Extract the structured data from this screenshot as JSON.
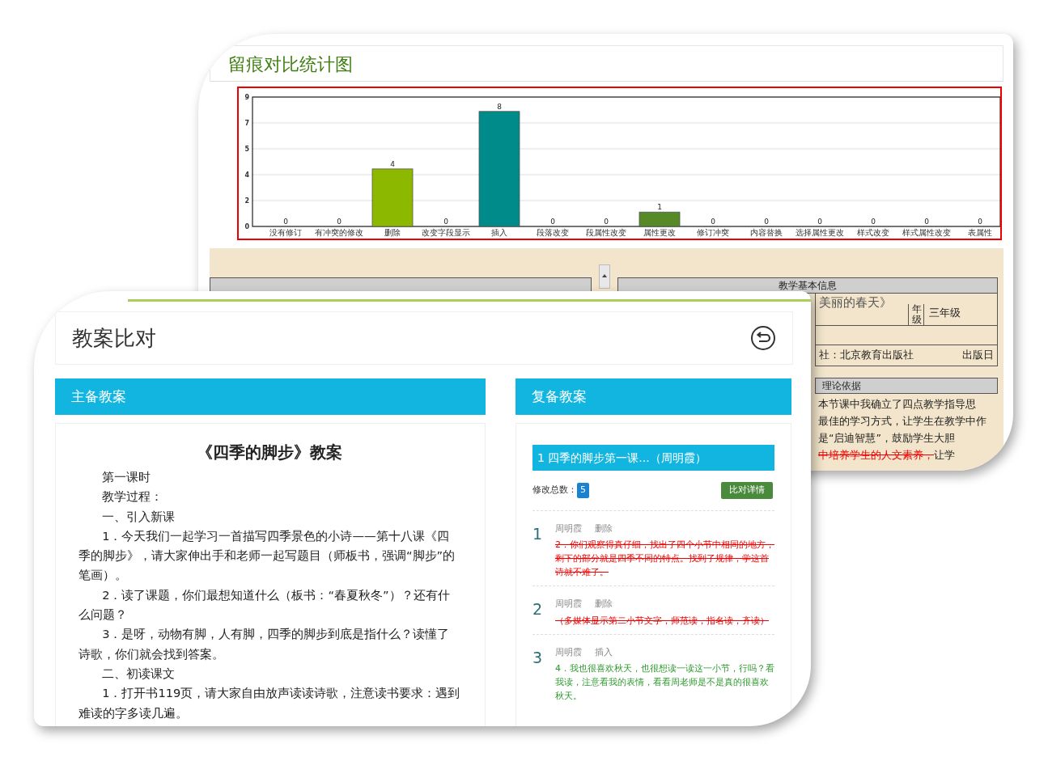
{
  "back_window": {
    "title": "留痕对比统计图",
    "chart": {
      "chart_data": {
        "type": "bar",
        "categories": [
          "没有修订",
          "有冲突的修改",
          "删除",
          "改变字段显示",
          "插入",
          "段落改变",
          "段属性改变",
          "属性更改",
          "修订冲突",
          "内容替换",
          "选择属性更改",
          "样式改变",
          "样式属性改变",
          "表属性"
        ],
        "series": [
          {
            "color": "#8cb800",
            "values": [
              0,
              0,
              4,
              0,
              null,
              0,
              0,
              null,
              0,
              0,
              0,
              0,
              0,
              0
            ]
          },
          {
            "color": "#008b8b",
            "values": [
              null,
              null,
              null,
              null,
              8,
              null,
              null,
              null,
              null,
              null,
              null,
              null,
              null,
              null
            ]
          },
          {
            "color": "#568a26",
            "values": [
              null,
              null,
              null,
              null,
              null,
              null,
              null,
              1,
              null,
              null,
              null,
              null,
              null,
              null
            ]
          }
        ],
        "grid": true,
        "ylim": [
          0,
          9
        ],
        "yticks": [
          0,
          {
            "value": 1.8,
            "label": "2"
          },
          {
            "value": 3.6,
            "label": "4"
          },
          {
            "value": 5.4,
            "label": "5"
          },
          {
            "value": 7.2,
            "label": "7"
          },
          9
        ],
        "data_labels": true
      }
    },
    "info_table": {
      "header": "教学基本信息",
      "title_fragment": "美丽的春天》",
      "grade_label": "年级",
      "grade": "三年级",
      "publisher": "社：北京教育出版社",
      "publish_date_label": "出版日"
    },
    "theory_table": {
      "header": "理论依据",
      "lines": [
        [
          {
            "text": "本节课中我确立了四点教学指导思",
            "kind": "normal"
          }
        ],
        [
          {
            "text": "最佳的学习方式，让学生在教学中作",
            "kind": "normal"
          }
        ],
        [
          {
            "text": "是“启迪智慧”，鼓励学生大胆",
            "kind": "normal"
          }
        ],
        [
          {
            "text": "中培养学生的人文素养，",
            "kind": "deleted"
          },
          {
            "text": "让学",
            "kind": "normal"
          }
        ]
      ]
    }
  },
  "front_window": {
    "title": "教案比对",
    "main_plan": {
      "header": "主备教案",
      "doc_title": "《四季的脚步》教案",
      "paragraphs": [
        "第一课时",
        "教学过程：",
        "一、引入新课",
        "1．今天我们一起学习一首描写四季景色的小诗——第十八课《四季的脚步》，请大家伸出手和老师一起写题目（师板书，强调“脚步”的笔画）。",
        "2．读了课题，你们最想知道什么（板书：“春夏秋冬”）？还有什么问题？",
        "3．是呀，动物有脚，人有脚，四季的脚步到底是指什么？读懂了诗歌，你们就会找到答案。",
        "二、初读课文",
        "1．打开书119页，请大家自由放声读读诗歌，注意读书要求：遇到难读的字多读几遍。"
      ]
    },
    "revised_plan": {
      "header": "复备教案",
      "entry_title": "1 四季的脚步第一课...（周明霞）",
      "total_label": "修改总数：",
      "total": "5",
      "compare_button": "比对详情",
      "revisions": [
        {
          "number": "1",
          "author": "周明霞",
          "action": "删除",
          "kind": "delete",
          "text": "2．你们观察得真仔细，找出了四个小节中相同的地方，剩下的部分就是四季不同的特点。找到了规律，学这首诗就不难了。"
        },
        {
          "number": "2",
          "author": "周明霞",
          "action": "删除",
          "kind": "delete",
          "text": "（多媒体显示第二小节文字，师范读，指名读，齐读）"
        },
        {
          "number": "3",
          "author": "周明霞",
          "action": "插入",
          "kind": "insert",
          "text": "4．我也很喜欢秋天，也很想读一读这一小节，行吗？看我读，注意看我的表情，看看周老师是不是真的很喜欢秋天。"
        }
      ]
    }
  }
}
